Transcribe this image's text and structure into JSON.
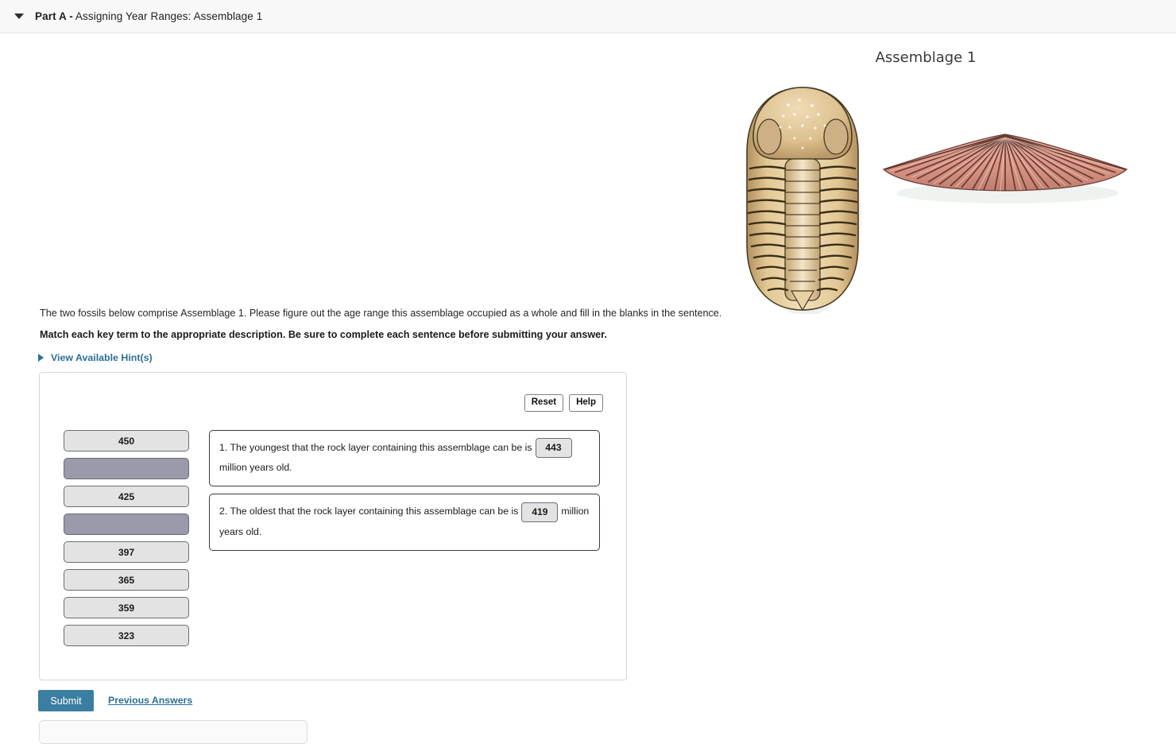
{
  "header": {
    "caret_icon": "caret-down-icon",
    "part_label": "Part A -",
    "part_title": "Assigning Year Ranges: Assemblage 1"
  },
  "figure": {
    "title": "Assemblage 1",
    "fossils": [
      {
        "name": "trilobite-fossil-illustration",
        "color": "#d9bd8d"
      },
      {
        "name": "brachiopod-fossil-illustration",
        "color": "#e3a99a"
      }
    ]
  },
  "body": {
    "prompt": "The two fossils below comprise Assemblage 1. Please figure out the age range this assemblage occupied as a whole and fill in the blanks in the sentence.",
    "prompt_bold": "Match each key term to the appropriate description. Be sure to complete each sentence before submitting your answer.",
    "hint_label": "View Available Hint(s)",
    "hint_caret_icon": "caret-right-icon"
  },
  "exercise": {
    "reset_label": "Reset",
    "help_label": "Help",
    "bank_tiles": [
      {
        "value": "450",
        "used": false
      },
      {
        "value": "",
        "used": true
      },
      {
        "value": "425",
        "used": false
      },
      {
        "value": "",
        "used": true
      },
      {
        "value": "397",
        "used": false
      },
      {
        "value": "365",
        "used": false
      },
      {
        "value": "359",
        "used": false
      },
      {
        "value": "323",
        "used": false
      }
    ],
    "statements": [
      {
        "lead": "1. The youngest that the rock layer containing this assemblage can be is",
        "answer": "443",
        "trail": "million years old."
      },
      {
        "lead": "2. The oldest that the rock layer containing this assemblage can be is",
        "answer": "419",
        "trail": "million years old."
      }
    ]
  },
  "footer": {
    "submit_label": "Submit",
    "previous_answers_label": "Previous Answers"
  },
  "colors": {
    "accent": "#2c6f97",
    "submit": "#3b7ea1",
    "tile_fill": "#e3e3e3",
    "tile_used": "#9a9aab"
  }
}
